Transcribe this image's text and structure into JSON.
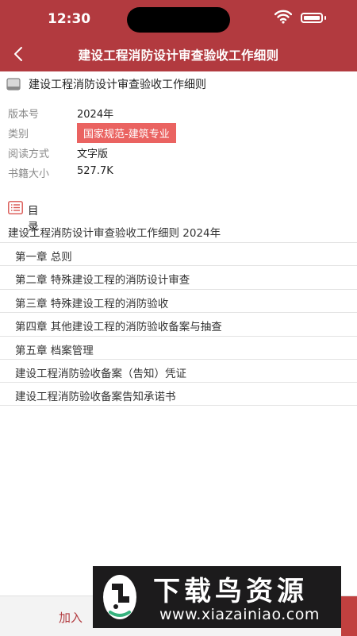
{
  "status_bar": {
    "time": "12:30"
  },
  "header": {
    "title": "建设工程消防设计审查验收工作细则"
  },
  "book": {
    "title": "建设工程消防设计审查验收工作细则",
    "meta": [
      {
        "label": "版本号",
        "value": "2024年"
      },
      {
        "label": "类别",
        "value": "国家规范-建筑专业"
      },
      {
        "label": "阅读方式",
        "value": "文字版"
      },
      {
        "label": "书籍大小",
        "value": "527.7K"
      }
    ]
  },
  "toc": {
    "heading": "目录",
    "book_line": "建设工程消防设计审查验收工作细则 2024年",
    "chapters": [
      "第一章 总则",
      "第二章 特殊建设工程的消防设计审查",
      "第三章 特殊建设工程的消防验收",
      "第四章 其他建设工程的消防验收备案与抽查",
      "第五章 档案管理",
      "建设工程消防验收备案（告知）凭证",
      "建设工程消防验收备案告知承诺书"
    ]
  },
  "bottom_bar": {
    "add_label": "加入"
  },
  "watermark": {
    "main": "下载鸟资源",
    "url": "www.xiazainiao.com"
  },
  "colors": {
    "brand": "#b23a3f",
    "badge": "#ea6361"
  },
  "icons": [
    "back-arrow-icon",
    "book-icon",
    "toc-list-icon",
    "wifi-icon",
    "battery-icon"
  ]
}
